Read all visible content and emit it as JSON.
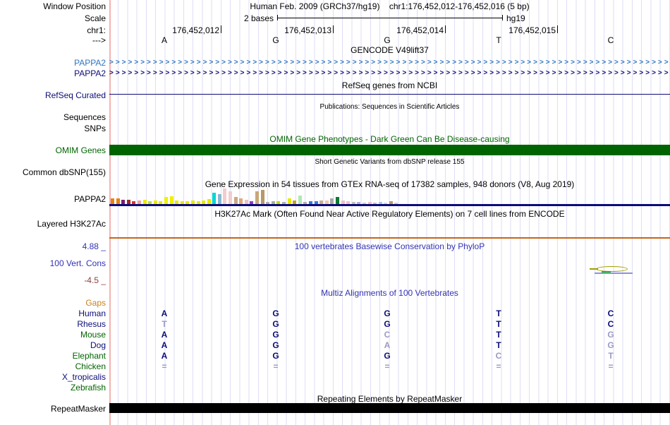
{
  "header": {
    "window_position_label": "Window Position",
    "assembly": "Human Feb. 2009 (GRCh37/hg19)",
    "position": "chr1:176,452,012-176,452,016 (5 bp)",
    "scale_label": "Scale",
    "scale_value": "2 bases",
    "assembly_short": "hg19",
    "chrom_label": "chr1:",
    "direction_label": "--->",
    "coordinates": [
      "176,452,012",
      "176,452,013",
      "176,452,014",
      "176,452,015"
    ],
    "bases": [
      "A",
      "G",
      "G",
      "T",
      "C"
    ]
  },
  "gencode": {
    "title": "GENCODE V49lift37",
    "transcripts": [
      {
        "label": "PAPPA2",
        "color": "#2f74c0"
      },
      {
        "label": "PAPPA2",
        "color": "#0c0c78"
      }
    ]
  },
  "refseq": {
    "title": "RefSeq genes from NCBI",
    "label": "RefSeq Curated",
    "line_color": "#0c0c78"
  },
  "publications": {
    "title": "Publications: Sequences in Scientific Articles",
    "labels": [
      "Sequences",
      "SNPs"
    ]
  },
  "omim": {
    "title": "OMIM Gene Phenotypes - Dark Green Can Be Disease-causing",
    "label": "OMIM Genes",
    "bar_color": "#006400"
  },
  "dbsnp": {
    "title": "Short Genetic Variants from dbSNP release 155",
    "label": "Common dbSNP(155)"
  },
  "gtex": {
    "title": "Gene Expression in 54 tissues from GTEx RNA-seq of 17382 samples, 948 donors (V8, Aug 2019)",
    "label": "PAPPA2",
    "baseline_color": "#0c0c78",
    "bars": [
      {
        "color": "#e8820e",
        "h": 8
      },
      {
        "color": "#e8820e",
        "h": 8
      },
      {
        "color": "#7a1e6e",
        "h": 6
      },
      {
        "color": "#a02828",
        "h": 6
      },
      {
        "color": "#e03030",
        "h": 4
      },
      {
        "color": "#f0a0a0",
        "h": 5
      },
      {
        "color": "#e8e800",
        "h": 6
      },
      {
        "color": "#b8d850",
        "h": 4
      },
      {
        "color": "#e8e800",
        "h": 5
      },
      {
        "color": "#e8e800",
        "h": 4
      },
      {
        "color": "#f0f000",
        "h": 10
      },
      {
        "color": "#f0f000",
        "h": 11
      },
      {
        "color": "#e8e800",
        "h": 5
      },
      {
        "color": "#e8e800",
        "h": 4
      },
      {
        "color": "#e8e800",
        "h": 4
      },
      {
        "color": "#e8e800",
        "h": 5
      },
      {
        "color": "#e8e800",
        "h": 4
      },
      {
        "color": "#e8e800",
        "h": 5
      },
      {
        "color": "#e8e800",
        "h": 7
      },
      {
        "color": "#00d8d8",
        "h": 16
      },
      {
        "color": "#88b8d0",
        "h": 14
      },
      {
        "color": "#f2cdcd",
        "h": 22
      },
      {
        "color": "#f2cdcd",
        "h": 18
      },
      {
        "color": "#c8a888",
        "h": 10
      },
      {
        "color": "#e0a878",
        "h": 8
      },
      {
        "color": "#f0c0c8",
        "h": 6
      },
      {
        "color": "#9040c0",
        "h": 4
      },
      {
        "color": "#c8a878",
        "h": 18
      },
      {
        "color": "#b89868",
        "h": 20
      },
      {
        "color": "#b0b0b0",
        "h": 3
      },
      {
        "color": "#98b898",
        "h": 4
      },
      {
        "color": "#c8d800",
        "h": 4
      },
      {
        "color": "#b0b0b0",
        "h": 3
      },
      {
        "color": "#e8e800",
        "h": 8
      },
      {
        "color": "#c8a020",
        "h": 5
      },
      {
        "color": "#b0e8b0",
        "h": 12
      },
      {
        "color": "#b0b0b0",
        "h": 3
      },
      {
        "color": "#3878e8",
        "h": 4
      },
      {
        "color": "#3878e8",
        "h": 4
      },
      {
        "color": "#c8b090",
        "h": 5
      },
      {
        "color": "#f8c8a0",
        "h": 5
      },
      {
        "color": "#a8a8a8",
        "h": 8
      },
      {
        "color": "#107830",
        "h": 10
      },
      {
        "color": "#f0c0c8",
        "h": 5
      },
      {
        "color": "#f0c0c8",
        "h": 4
      },
      {
        "color": "#c0c0c0",
        "h": 3
      },
      {
        "color": "#b0b0e8",
        "h": 3
      },
      {
        "color": "#d0d0d0",
        "h": 2
      },
      {
        "color": "#f0c0c8",
        "h": 3
      },
      {
        "color": "#c0c0c0",
        "h": 2
      },
      {
        "color": "#a8c8e8",
        "h": 3
      },
      {
        "color": "#d8d8d8",
        "h": 2
      },
      {
        "color": "#b89868",
        "h": 4
      },
      {
        "color": "#d0d0d0",
        "h": 2
      }
    ]
  },
  "h3k27ac": {
    "title": "H3K27Ac Mark (Often Found Near Active Regulatory Elements) on 7 cell lines from ENCODE",
    "label": "Layered H3K27Ac",
    "line_color": "#c86414"
  },
  "conservation": {
    "title": "100 vertebrates Basewise Conservation by PhyloP",
    "label": "100 Vert. Cons",
    "max_label": "4.88 _",
    "min_label": "-4.5 _",
    "glyph_colors": {
      "olive": "#a0a000",
      "green": "#00d000",
      "blue": "#9090dd"
    }
  },
  "multiz": {
    "title": "Multiz Alignments of 100 Vertebrates",
    "rows": [
      {
        "name": "Gaps",
        "color": "#c8821e",
        "bases": null
      },
      {
        "name": "Human",
        "color": "#0c0c78",
        "bases": [
          {
            "t": "A",
            "light": false
          },
          {
            "t": "G",
            "light": false
          },
          {
            "t": "G",
            "light": false
          },
          {
            "t": "T",
            "light": false
          },
          {
            "t": "C",
            "light": false
          }
        ]
      },
      {
        "name": "Rhesus",
        "color": "#0c0c78",
        "bases": [
          {
            "t": "T",
            "light": true
          },
          {
            "t": "G",
            "light": false
          },
          {
            "t": "G",
            "light": false
          },
          {
            "t": "T",
            "light": false
          },
          {
            "t": "C",
            "light": false
          }
        ]
      },
      {
        "name": "Mouse",
        "color": "#006400",
        "bases": [
          {
            "t": "A",
            "light": false
          },
          {
            "t": "G",
            "light": false
          },
          {
            "t": "C",
            "light": true
          },
          {
            "t": "T",
            "light": false
          },
          {
            "t": "G",
            "light": true
          }
        ]
      },
      {
        "name": "Dog",
        "color": "#0c0c78",
        "bases": [
          {
            "t": "A",
            "light": false
          },
          {
            "t": "G",
            "light": false
          },
          {
            "t": "A",
            "light": true
          },
          {
            "t": "T",
            "light": false
          },
          {
            "t": "G",
            "light": true
          }
        ]
      },
      {
        "name": "Elephant",
        "color": "#006400",
        "bases": [
          {
            "t": "A",
            "light": false
          },
          {
            "t": "G",
            "light": false
          },
          {
            "t": "G",
            "light": false
          },
          {
            "t": "C",
            "light": true
          },
          {
            "t": "T",
            "light": true
          }
        ]
      },
      {
        "name": "Chicken",
        "color": "#006400",
        "bases": [
          {
            "t": "=",
            "light": true
          },
          {
            "t": "=",
            "light": true
          },
          {
            "t": "=",
            "light": true
          },
          {
            "t": "=",
            "light": true
          },
          {
            "t": "=",
            "light": true
          }
        ]
      },
      {
        "name": "X_tropicalis",
        "color": "#0c0c78",
        "bases": null
      },
      {
        "name": "Zebrafish",
        "color": "#006400",
        "bases": null
      }
    ]
  },
  "repeatmasker": {
    "title": "Repeating Elements by RepeatMasker",
    "label": "RepeatMasker",
    "bar_color": "#000000"
  }
}
